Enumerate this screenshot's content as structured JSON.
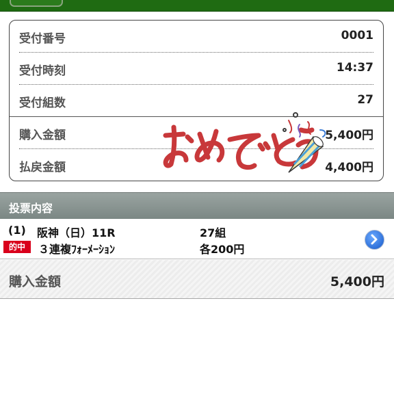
{
  "receipt": {
    "rows": [
      {
        "label": "受付番号",
        "value": "0001"
      },
      {
        "label": "受付時刻",
        "value": "14:37"
      },
      {
        "label": "受付組数",
        "value": "27"
      },
      {
        "label": "購入金額",
        "value": "5,400円"
      },
      {
        "label": "払戻金額",
        "value": "4,400円"
      }
    ],
    "celebration_image": "omedetou-party-popper"
  },
  "bets": {
    "section_title": "投票内容",
    "item": {
      "index": "(1)",
      "race": "阪神（日）11R",
      "combos": "27組",
      "hit_badge": "的中",
      "bet_type": "３連複ﾌｫｰﾒｰｼｮﾝ",
      "per_bet": "各200円"
    },
    "detail_icon": "chevron-right-circle-icon"
  },
  "total": {
    "label": "購入金額",
    "value": "5,400円"
  },
  "colors": {
    "header_green": "#1f6b12",
    "hit_red": "#d9001b",
    "section_gray": "#8a9592"
  }
}
